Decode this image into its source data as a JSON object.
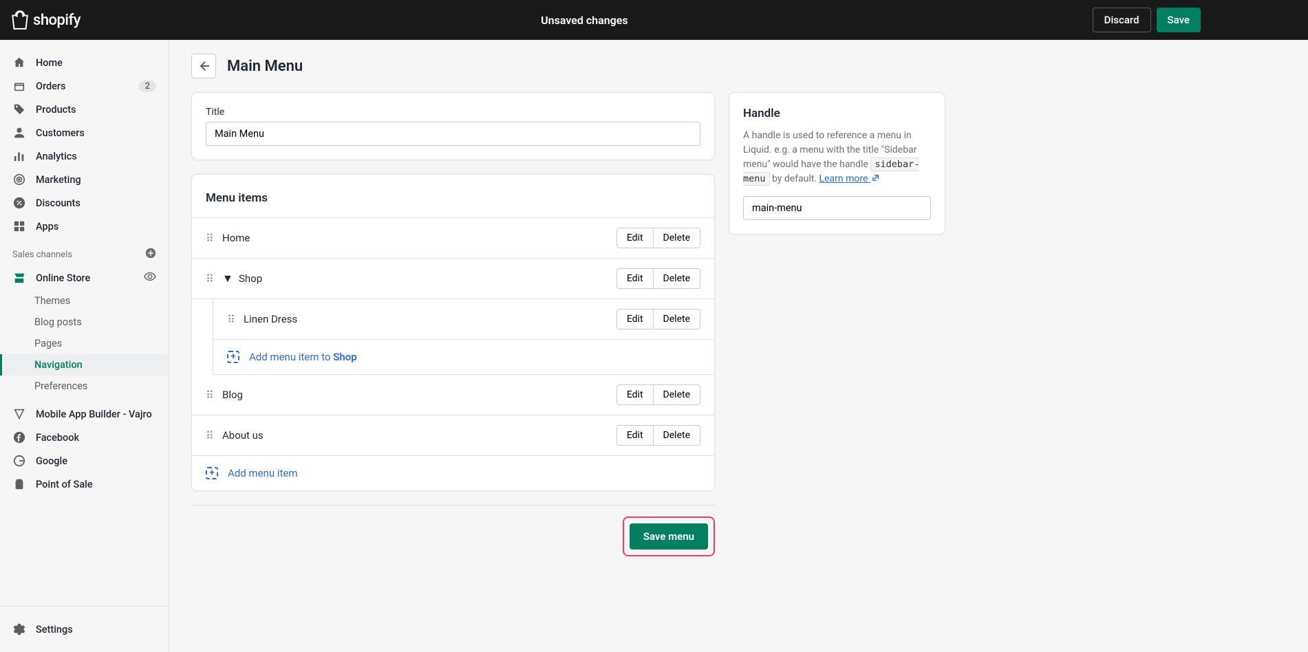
{
  "topbar": {
    "logo_text": "shopify",
    "status": "Unsaved changes",
    "discard": "Discard",
    "save": "Save"
  },
  "sidebar": {
    "home": "Home",
    "orders": "Orders",
    "orders_badge": "2",
    "products": "Products",
    "customers": "Customers",
    "analytics": "Analytics",
    "marketing": "Marketing",
    "discounts": "Discounts",
    "apps": "Apps",
    "section_channels": "Sales channels",
    "online_store": "Online Store",
    "themes": "Themes",
    "blog_posts": "Blog posts",
    "pages": "Pages",
    "navigation": "Navigation",
    "preferences": "Preferences",
    "vajro": "Mobile App Builder - Vajro",
    "facebook": "Facebook",
    "google": "Google",
    "pos": "Point of Sale",
    "settings": "Settings"
  },
  "page": {
    "title": "Main Menu"
  },
  "title_card": {
    "label": "Title",
    "value": "Main Menu"
  },
  "menu_items": {
    "header": "Menu items",
    "edit": "Edit",
    "delete": "Delete",
    "items": {
      "home": "Home",
      "shop": "Shop",
      "linen": "Linen Dress",
      "blog": "Blog",
      "about": "About us"
    },
    "add_to_shop_prefix": "Add menu item to ",
    "add_to_shop_target": "Shop",
    "add_item": "Add menu item"
  },
  "handle": {
    "title": "Handle",
    "desc_1": "A handle is used to reference a menu in Liquid. e.g. a menu with the title \"Sidebar menu\" would have the handle ",
    "desc_code": "sidebar-menu",
    "desc_2": " by default. ",
    "learn_more": "Learn more",
    "value": "main-menu"
  },
  "footer": {
    "save_menu": "Save menu"
  }
}
